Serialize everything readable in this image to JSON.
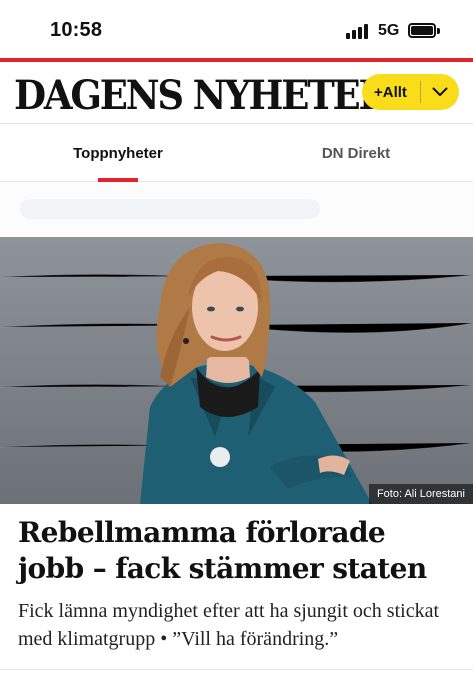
{
  "status_bar": {
    "time": "10:58",
    "network": "5G"
  },
  "header": {
    "logo": "DAGENS NYHETER.",
    "allt_button_label": "+Allt",
    "allt_button_color": "#f9dd1a"
  },
  "tabs": [
    {
      "label": "Toppnyheter",
      "active": true
    },
    {
      "label": "DN Direkt",
      "active": false
    }
  ],
  "accent_color": "#e3232b",
  "article": {
    "photo_credit": "Foto: Ali Lorestani",
    "headline": "Rebellmamma förlorade jobb – fack stämmer staten",
    "summary": "Fick lämna myndighet efter att ha sjungit och stickat med klimatgrupp • ”Vill ha förändring.”"
  },
  "icons": {
    "signal": "signal-icon",
    "battery": "battery-icon",
    "dropdown": "chevron-down-icon"
  }
}
